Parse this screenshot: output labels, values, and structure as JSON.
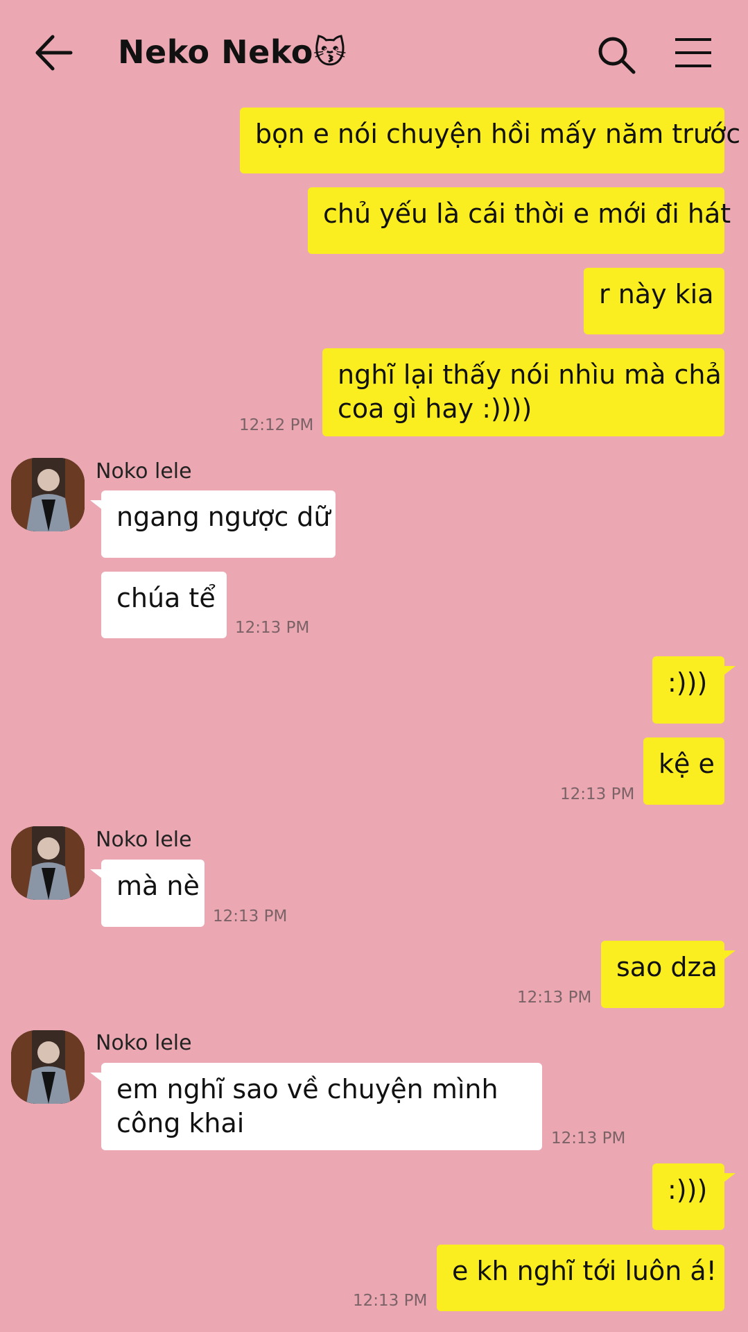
{
  "header": {
    "title": "Neko Neko",
    "title_emoji": "😽"
  },
  "contact": {
    "name": "Noko lele"
  },
  "colors": {
    "background": "#eba8b2",
    "outgoing_bubble": "#fbee20",
    "incoming_bubble": "#ffffff"
  },
  "messages": [
    {
      "dir": "out",
      "text": "bọn e nói chuyện hồi mấy năm trước"
    },
    {
      "dir": "out",
      "text": "chủ yếu là cái thời e mới đi hát"
    },
    {
      "dir": "out",
      "text": "r này kia"
    },
    {
      "dir": "out",
      "text_line1": "nghĩ lại thấy nói nhìu mà chả",
      "text_line2": "coa gì hay :))))",
      "time": "12:12 PM"
    },
    {
      "dir": "in",
      "text": "ngang ngược dữ"
    },
    {
      "dir": "in",
      "text": "chúa tể",
      "time": "12:13 PM"
    },
    {
      "dir": "out",
      "text": ":)))"
    },
    {
      "dir": "out",
      "text": "kệ e",
      "time": "12:13 PM"
    },
    {
      "dir": "in",
      "text": "mà nè",
      "time": "12:13 PM"
    },
    {
      "dir": "out",
      "text": "sao dza",
      "time": "12:13 PM"
    },
    {
      "dir": "in",
      "text_line1": "em nghĩ sao về chuyện mình",
      "text_line2": "công khai",
      "time": "12:13 PM"
    },
    {
      "dir": "out",
      "text": ":)))"
    },
    {
      "dir": "out",
      "text": "e kh nghĩ tới luôn á!",
      "time": "12:13 PM"
    }
  ]
}
